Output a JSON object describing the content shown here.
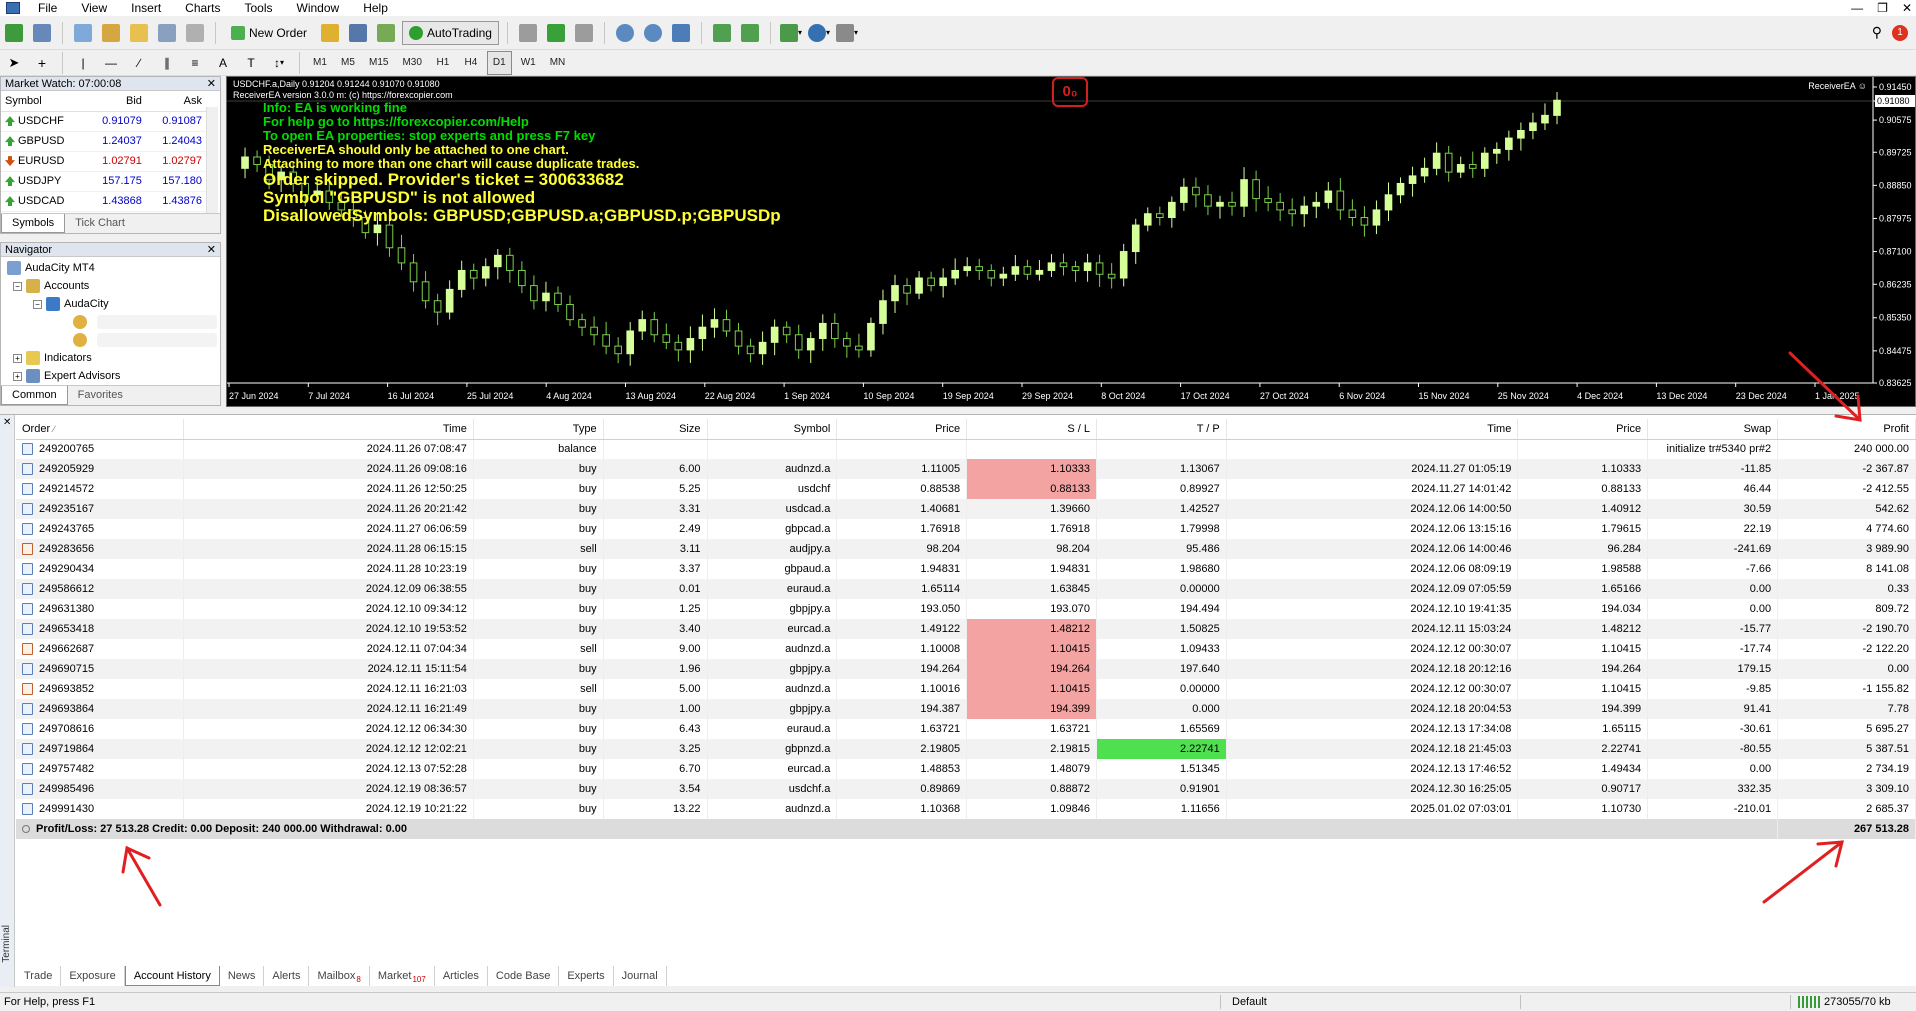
{
  "menu": [
    "File",
    "View",
    "Insert",
    "Charts",
    "Tools",
    "Window",
    "Help"
  ],
  "toolbar": {
    "new_order": "New Order",
    "autotrading": "AutoTrading",
    "timeframes": [
      "M1",
      "M5",
      "M15",
      "M30",
      "H1",
      "H4",
      "D1",
      "W1",
      "MN"
    ],
    "active_timeframe": "D1",
    "notification_count": "1"
  },
  "market_watch": {
    "title": "Market Watch: 07:00:08",
    "columns": [
      "Symbol",
      "Bid",
      "Ask"
    ],
    "rows": [
      {
        "symbol": "USDCHF",
        "bid": "0.91079",
        "ask": "0.91087",
        "dir": "up"
      },
      {
        "symbol": "GBPUSD",
        "bid": "1.24037",
        "ask": "1.24043",
        "dir": "up"
      },
      {
        "symbol": "EURUSD",
        "bid": "1.02791",
        "ask": "1.02797",
        "dir": "down"
      },
      {
        "symbol": "USDJPY",
        "bid": "157.175",
        "ask": "157.180",
        "dir": "up"
      },
      {
        "symbol": "USDCAD",
        "bid": "1.43868",
        "ask": "1.43876",
        "dir": "up"
      }
    ],
    "tabs": [
      "Symbols",
      "Tick Chart"
    ]
  },
  "navigator": {
    "title": "Navigator",
    "items": [
      "AudaCity MT4",
      "Accounts",
      "AudaCity",
      "Indicators",
      "Expert Advisors"
    ],
    "tabs": [
      "Common",
      "Favorites"
    ]
  },
  "chart": {
    "header_line1": "USDCHF.a,Daily  0.91204 0.91244 0.91070 0.91080",
    "header_line2": "ReceiverEA version 3.0.0 m: (c) https://forexcopier.com",
    "ea_label": "ReceiverEA ☺",
    "messages_green": [
      "Info: EA is working fine",
      "For help go to https://forexcopier.com/Help",
      "To open EA properties: stop experts and press F7 key"
    ],
    "messages_yellow": [
      "ReceiverEA should only be attached to one chart.",
      "Attaching to more than one chart will cause duplicate trades."
    ],
    "messages_big": [
      "Order skipped. Provider's ticket = 300633682",
      "Symbol \"GBPUSD\" is not allowed",
      "DisallowedSymbols: GBPUSD;GBPUSD.a;GBPUSD.p;GBPUSDp"
    ],
    "logo_text": "0₀",
    "colors": {
      "bull": "#d6ff9a",
      "bear": "#7ad04a",
      "background": "#000000"
    }
  },
  "chart_data": {
    "type": "candlestick",
    "symbol": "USDCHF.a",
    "timeframe": "Daily",
    "ohlc_last": {
      "open": 0.91204,
      "high": 0.91244,
      "low": 0.9107,
      "close": 0.9108
    },
    "y_ticks": [
      "0.91450",
      "0.91080",
      "0.90575",
      "0.89725",
      "0.88850",
      "0.87975",
      "0.87100",
      "0.86235",
      "0.85350",
      "0.84475",
      "0.83625"
    ],
    "x_ticks": [
      "27 Jun 2024",
      "7 Jul 2024",
      "16 Jul 2024",
      "25 Jul 2024",
      "4 Aug 2024",
      "13 Aug 2024",
      "22 Aug 2024",
      "1 Sep 2024",
      "10 Sep 2024",
      "19 Sep 2024",
      "29 Sep 2024",
      "8 Oct 2024",
      "17 Oct 2024",
      "27 Oct 2024",
      "6 Nov 2024",
      "15 Nov 2024",
      "25 Nov 2024",
      "4 Dec 2024",
      "13 Dec 2024",
      "23 Dec 2024",
      "1 Jan 2025"
    ],
    "close_path": [
      0.893,
      0.896,
      0.894,
      0.89,
      0.892,
      0.889,
      0.886,
      0.887,
      0.884,
      0.882,
      0.88,
      0.876,
      0.878,
      0.872,
      0.868,
      0.863,
      0.858,
      0.855,
      0.861,
      0.866,
      0.864,
      0.867,
      0.87,
      0.866,
      0.862,
      0.858,
      0.86,
      0.857,
      0.853,
      0.851,
      0.849,
      0.846,
      0.844,
      0.85,
      0.853,
      0.849,
      0.847,
      0.845,
      0.848,
      0.851,
      0.853,
      0.85,
      0.846,
      0.844,
      0.847,
      0.851,
      0.849,
      0.845,
      0.848,
      0.852,
      0.848,
      0.846,
      0.845,
      0.852,
      0.858,
      0.862,
      0.86,
      0.864,
      0.862,
      0.864,
      0.866,
      0.867,
      0.866,
      0.864,
      0.865,
      0.867,
      0.865,
      0.866,
      0.868,
      0.867,
      0.866,
      0.868,
      0.865,
      0.864,
      0.871,
      0.878,
      0.881,
      0.88,
      0.884,
      0.888,
      0.886,
      0.883,
      0.884,
      0.883,
      0.89,
      0.885,
      0.884,
      0.882,
      0.881,
      0.883,
      0.884,
      0.887,
      0.882,
      0.88,
      0.878,
      0.882,
      0.886,
      0.889,
      0.891,
      0.893,
      0.897,
      0.892,
      0.894,
      0.893,
      0.897,
      0.898,
      0.901,
      0.903,
      0.905,
      0.907,
      0.911
    ]
  },
  "history": {
    "columns": [
      "Order",
      "Time",
      "Type",
      "Size",
      "Symbol",
      "Price",
      "S / L",
      "T / P",
      "Time",
      "Price",
      "Swap",
      "Profit"
    ],
    "rows": [
      {
        "order": "249200765",
        "time": "2024.11.26 07:08:47",
        "type": "balance",
        "size": "",
        "symbol": "",
        "price": "",
        "sl": "",
        "tp": "",
        "ctime": "",
        "cprice": "",
        "swap": "initialize tr#5340 pr#2",
        "profit": "240 000.00",
        "mark": ""
      },
      {
        "order": "249205929",
        "time": "2024.11.26 09:08:16",
        "type": "buy",
        "size": "6.00",
        "symbol": "audnzd.a",
        "price": "1.11005",
        "sl": "1.10333",
        "tp": "1.13067",
        "ctime": "2024.11.27 01:05:19",
        "cprice": "1.10333",
        "swap": "-11.85",
        "profit": "-2 367.87",
        "mark": "sl"
      },
      {
        "order": "249214572",
        "time": "2024.11.26 12:50:25",
        "type": "buy",
        "size": "5.25",
        "symbol": "usdchf",
        "price": "0.88538",
        "sl": "0.88133",
        "tp": "0.89927",
        "ctime": "2024.11.27 14:01:42",
        "cprice": "0.88133",
        "swap": "46.44",
        "profit": "-2 412.55",
        "mark": "sl"
      },
      {
        "order": "249235167",
        "time": "2024.11.26 20:21:42",
        "type": "buy",
        "size": "3.31",
        "symbol": "usdcad.a",
        "price": "1.40681",
        "sl": "1.39660",
        "tp": "1.42527",
        "ctime": "2024.12.06 14:00:50",
        "cprice": "1.40912",
        "swap": "30.59",
        "profit": "542.62",
        "mark": ""
      },
      {
        "order": "249243765",
        "time": "2024.11.27 06:06:59",
        "type": "buy",
        "size": "2.49",
        "symbol": "gbpcad.a",
        "price": "1.76918",
        "sl": "1.76918",
        "tp": "1.79998",
        "ctime": "2024.12.06 13:15:16",
        "cprice": "1.79615",
        "swap": "22.19",
        "profit": "4 774.60",
        "mark": ""
      },
      {
        "order": "249283656",
        "time": "2024.11.28 06:15:15",
        "type": "sell",
        "size": "3.11",
        "symbol": "audjpy.a",
        "price": "98.204",
        "sl": "98.204",
        "tp": "95.486",
        "ctime": "2024.12.06 14:00:46",
        "cprice": "96.284",
        "swap": "-241.69",
        "profit": "3 989.90",
        "mark": ""
      },
      {
        "order": "249290434",
        "time": "2024.11.28 10:23:19",
        "type": "buy",
        "size": "3.37",
        "symbol": "gbpaud.a",
        "price": "1.94831",
        "sl": "1.94831",
        "tp": "1.98680",
        "ctime": "2024.12.06 08:09:19",
        "cprice": "1.98588",
        "swap": "-7.66",
        "profit": "8 141.08",
        "mark": ""
      },
      {
        "order": "249586612",
        "time": "2024.12.09 06:38:55",
        "type": "buy",
        "size": "0.01",
        "symbol": "euraud.a",
        "price": "1.65114",
        "sl": "1.63845",
        "tp": "0.00000",
        "ctime": "2024.12.09 07:05:59",
        "cprice": "1.65166",
        "swap": "0.00",
        "profit": "0.33",
        "mark": ""
      },
      {
        "order": "249631380",
        "time": "2024.12.10 09:34:12",
        "type": "buy",
        "size": "1.25",
        "symbol": "gbpjpy.a",
        "price": "193.050",
        "sl": "193.070",
        "tp": "194.494",
        "ctime": "2024.12.10 19:41:35",
        "cprice": "194.034",
        "swap": "0.00",
        "profit": "809.72",
        "mark": ""
      },
      {
        "order": "249653418",
        "time": "2024.12.10 19:53:52",
        "type": "buy",
        "size": "3.40",
        "symbol": "eurcad.a",
        "price": "1.49122",
        "sl": "1.48212",
        "tp": "1.50825",
        "ctime": "2024.12.11 15:03:24",
        "cprice": "1.48212",
        "swap": "-15.77",
        "profit": "-2 190.70",
        "mark": "sl"
      },
      {
        "order": "249662687",
        "time": "2024.12.11 07:04:34",
        "type": "sell",
        "size": "9.00",
        "symbol": "audnzd.a",
        "price": "1.10008",
        "sl": "1.10415",
        "tp": "1.09433",
        "ctime": "2024.12.12 00:30:07",
        "cprice": "1.10415",
        "swap": "-17.74",
        "profit": "-2 122.20",
        "mark": "sl"
      },
      {
        "order": "249690715",
        "time": "2024.12.11 15:11:54",
        "type": "buy",
        "size": "1.96",
        "symbol": "gbpjpy.a",
        "price": "194.264",
        "sl": "194.264",
        "tp": "197.640",
        "ctime": "2024.12.18 20:12:16",
        "cprice": "194.264",
        "swap": "179.15",
        "profit": "0.00",
        "mark": "sl"
      },
      {
        "order": "249693852",
        "time": "2024.12.11 16:21:03",
        "type": "sell",
        "size": "5.00",
        "symbol": "audnzd.a",
        "price": "1.10016",
        "sl": "1.10415",
        "tp": "0.00000",
        "ctime": "2024.12.12 00:30:07",
        "cprice": "1.10415",
        "swap": "-9.85",
        "profit": "-1 155.82",
        "mark": "sl"
      },
      {
        "order": "249693864",
        "time": "2024.12.11 16:21:49",
        "type": "buy",
        "size": "1.00",
        "symbol": "gbpjpy.a",
        "price": "194.387",
        "sl": "194.399",
        "tp": "0.000",
        "ctime": "2024.12.18 20:04:53",
        "cprice": "194.399",
        "swap": "91.41",
        "profit": "7.78",
        "mark": "sl"
      },
      {
        "order": "249708616",
        "time": "2024.12.12 06:34:30",
        "type": "buy",
        "size": "6.43",
        "symbol": "euraud.a",
        "price": "1.63721",
        "sl": "1.63721",
        "tp": "1.65569",
        "ctime": "2024.12.13 17:34:08",
        "cprice": "1.65115",
        "swap": "-30.61",
        "profit": "5 695.27",
        "mark": ""
      },
      {
        "order": "249719864",
        "time": "2024.12.12 12:02:21",
        "type": "buy",
        "size": "3.25",
        "symbol": "gbpnzd.a",
        "price": "2.19805",
        "sl": "2.19815",
        "tp": "2.22741",
        "ctime": "2024.12.18 21:45:03",
        "cprice": "2.22741",
        "swap": "-80.55",
        "profit": "5 387.51",
        "mark": "tp"
      },
      {
        "order": "249757482",
        "time": "2024.12.13 07:52:28",
        "type": "buy",
        "size": "6.70",
        "symbol": "eurcad.a",
        "price": "1.48853",
        "sl": "1.48079",
        "tp": "1.51345",
        "ctime": "2024.12.13 17:46:52",
        "cprice": "1.49434",
        "swap": "0.00",
        "profit": "2 734.19",
        "mark": ""
      },
      {
        "order": "249985496",
        "time": "2024.12.19 08:36:57",
        "type": "buy",
        "size": "3.54",
        "symbol": "usdchf.a",
        "price": "0.89869",
        "sl": "0.88872",
        "tp": "0.91901",
        "ctime": "2024.12.30 16:25:05",
        "cprice": "0.90717",
        "swap": "332.35",
        "profit": "3 309.10",
        "mark": ""
      },
      {
        "order": "249991430",
        "time": "2024.12.19 10:21:22",
        "type": "buy",
        "size": "13.22",
        "symbol": "audnzd.a",
        "price": "1.10368",
        "sl": "1.09846",
        "tp": "1.11656",
        "ctime": "2025.01.02 07:03:01",
        "cprice": "1.10730",
        "swap": "-210.01",
        "profit": "2 685.37",
        "mark": ""
      }
    ],
    "summary_left": "Profit/Loss: 27 513.28  Credit: 0.00  Deposit: 240 000.00  Withdrawal: 0.00",
    "summary_right": "267 513.28"
  },
  "terminal": {
    "side_label": "Terminal",
    "tabs": [
      {
        "label": "Trade",
        "badge": ""
      },
      {
        "label": "Exposure",
        "badge": ""
      },
      {
        "label": "Account History",
        "badge": ""
      },
      {
        "label": "News",
        "badge": ""
      },
      {
        "label": "Alerts",
        "badge": ""
      },
      {
        "label": "Mailbox",
        "badge": "8"
      },
      {
        "label": "Market",
        "badge": "107"
      },
      {
        "label": "Articles",
        "badge": ""
      },
      {
        "label": "Code Base",
        "badge": ""
      },
      {
        "label": "Experts",
        "badge": ""
      },
      {
        "label": "Journal",
        "badge": ""
      }
    ],
    "active_tab": "Account History"
  },
  "status": {
    "help": "For Help, press F1",
    "profile": "Default",
    "connection": "273055/70 kb"
  }
}
